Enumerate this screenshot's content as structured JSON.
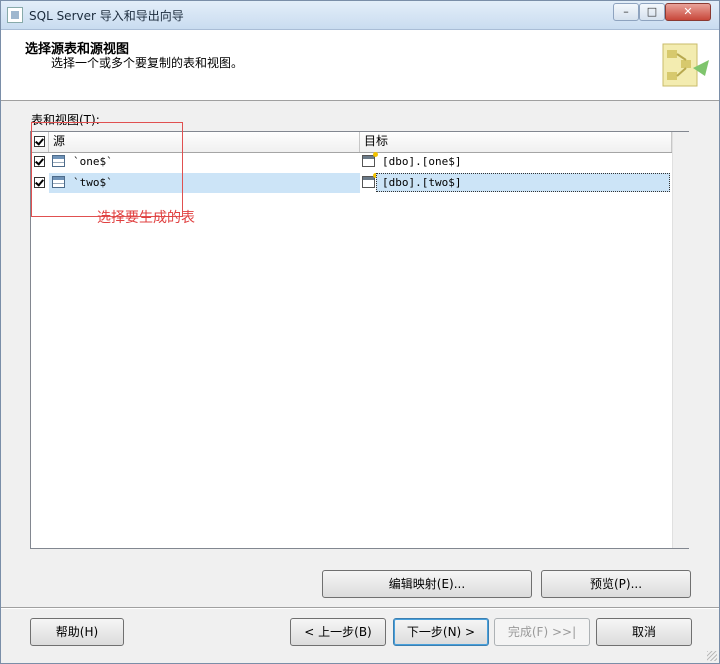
{
  "window": {
    "title": "SQL Server 导入和导出向导",
    "controls": {
      "minimize": "–",
      "maximize": "□",
      "close": "✕"
    }
  },
  "header": {
    "title": "选择源表和源视图",
    "subtitle": "选择一个或多个要复制的表和视图。"
  },
  "tables_label": "表和视图(T):",
  "grid": {
    "columns": {
      "source": "源",
      "destination": "目标"
    },
    "rows": [
      {
        "checked": true,
        "source": "`one$`",
        "destination": "[dbo].[one$]"
      },
      {
        "checked": true,
        "source": "`two$`",
        "destination": "[dbo].[two$]"
      }
    ]
  },
  "annotation": {
    "text": "选择要生成的表",
    "color": "#e04040"
  },
  "buttons": {
    "edit_mappings": "编辑映射(E)...",
    "preview": "预览(P)...",
    "help": "帮助(H)",
    "back": "< 上一步(B)",
    "next": "下一步(N) >",
    "finish": "完成(F) >>|",
    "cancel": "取消"
  }
}
